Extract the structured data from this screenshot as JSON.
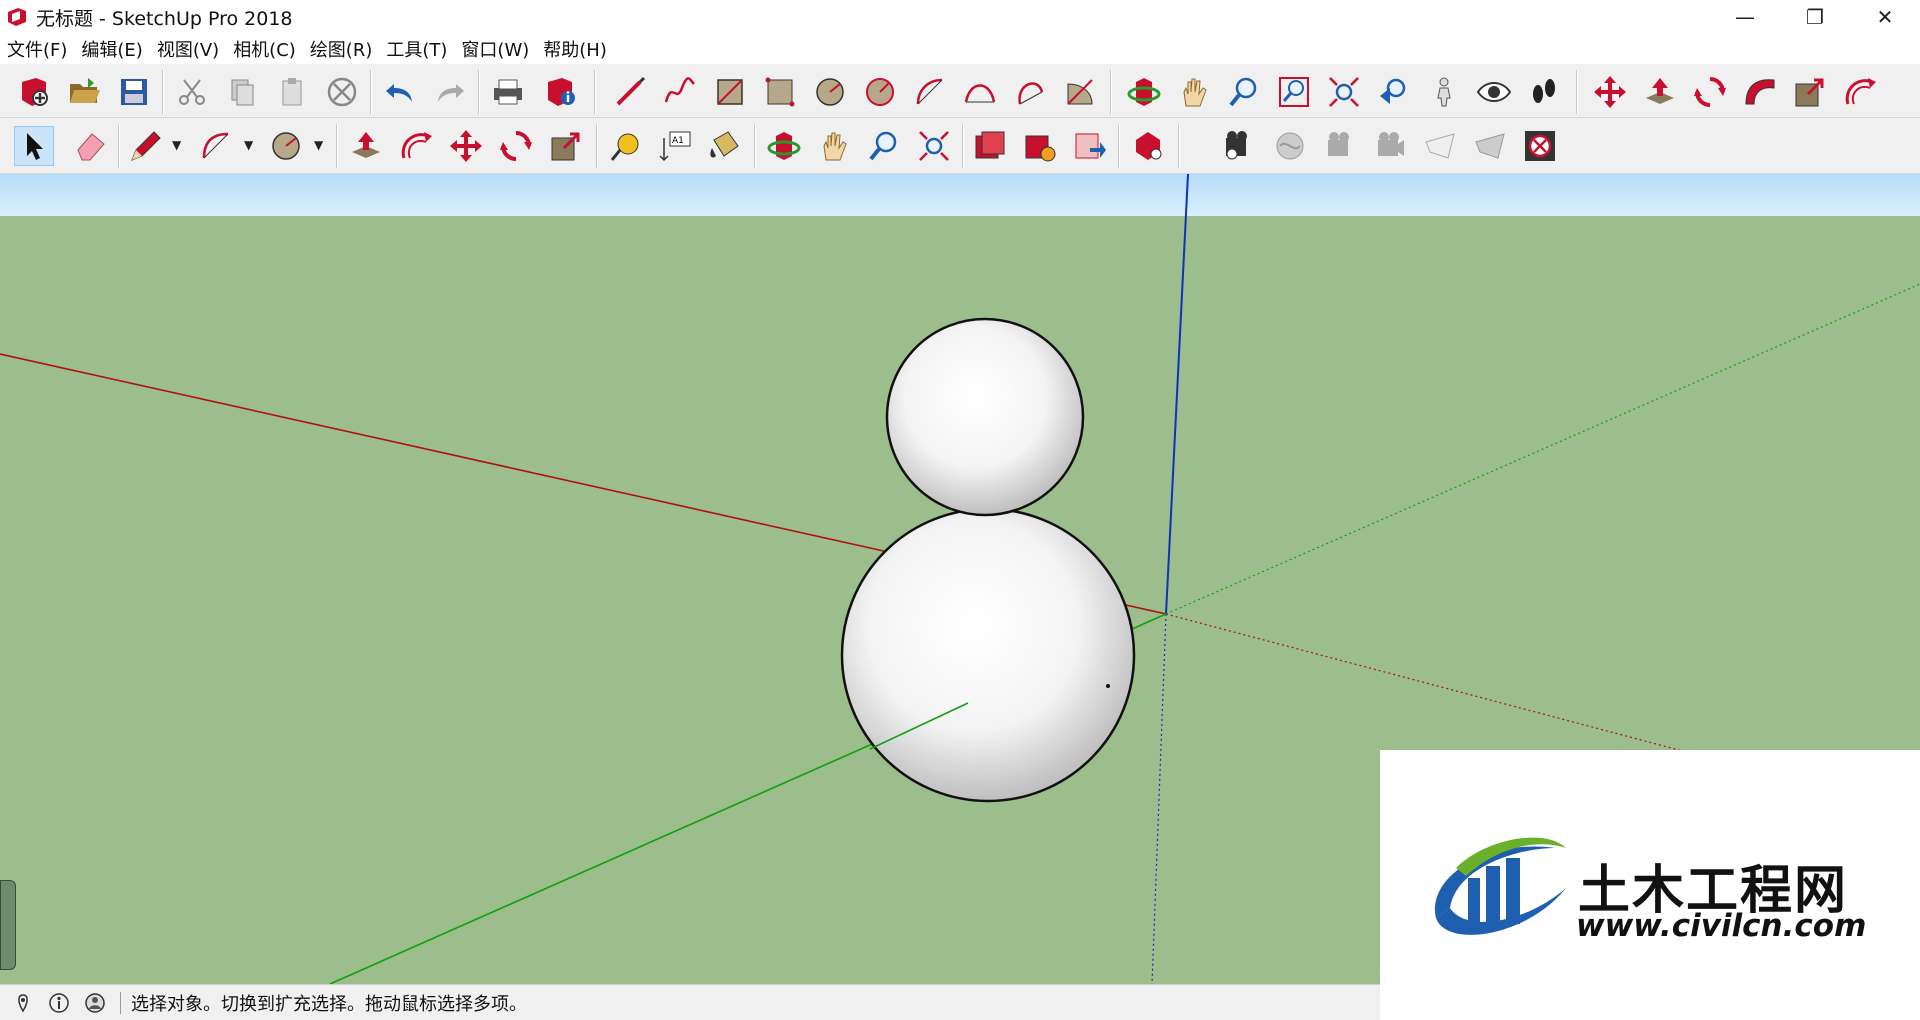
{
  "window": {
    "title": "无标题 - SketchUp Pro 2018",
    "controls": {
      "minimize": "—",
      "maximize": "❐",
      "close": "✕"
    }
  },
  "menu": [
    "文件(F)",
    "编辑(E)",
    "视图(V)",
    "相机(C)",
    "绘图(R)",
    "工具(T)",
    "窗口(W)",
    "帮助(H)"
  ],
  "toolbar1": {
    "icons": [
      "new-model-icon",
      "open-icon",
      "save-icon",
      "cut-icon",
      "copy-icon",
      "paste-icon",
      "erase-icon",
      "undo-icon",
      "redo-icon",
      "print-icon",
      "model-info-icon",
      "line-icon",
      "freehand-icon",
      "rectangle-icon",
      "rotated-rectangle-icon",
      "circle-icon",
      "polygon-icon",
      "arc-icon",
      "two-point-arc-icon",
      "three-point-arc-icon",
      "pie-icon",
      "orbit-icon",
      "pan-icon",
      "zoom-icon",
      "zoom-window-icon",
      "zoom-extents-icon",
      "previous-view-icon",
      "position-camera-icon",
      "look-around-icon",
      "walk-icon",
      "move-icon",
      "push-pull-icon",
      "rotate-icon",
      "follow-me-icon",
      "scale-icon",
      "offset-icon"
    ]
  },
  "toolbar2": {
    "icons": [
      "select-icon",
      "eraser-icon",
      "pencil-icon",
      "arc-dropdown-icon",
      "circle-dropdown-icon",
      "push-pull-icon",
      "offset-icon",
      "move-icon",
      "rotate-icon",
      "scale-icon",
      "tape-measure-icon",
      "text-icon",
      "paint-bucket-icon",
      "orbit-icon",
      "pan-icon",
      "zoom-icon",
      "zoom-extents-icon",
      "warehouse-icon",
      "share-model-icon",
      "upload-icon",
      "extension-warehouse-icon",
      "match-photo-icon",
      "edit-photo-icon",
      "camera-icon",
      "camera-2-icon",
      "plane-icon",
      "plane-2-icon",
      "clear-icon"
    ]
  },
  "status": {
    "message": "选择对象。切换到扩充选择。拖动鼠标选择多项。"
  },
  "watermark": {
    "cn": "土木工程网",
    "url": "www.civilcn.com"
  },
  "colors": {
    "sky": "#c3e4fb",
    "ground": "#9cbd8c",
    "axis_red": "#b01010",
    "axis_green": "#10a010",
    "axis_blue": "#1030c0",
    "icon_red": "#c8102e"
  }
}
